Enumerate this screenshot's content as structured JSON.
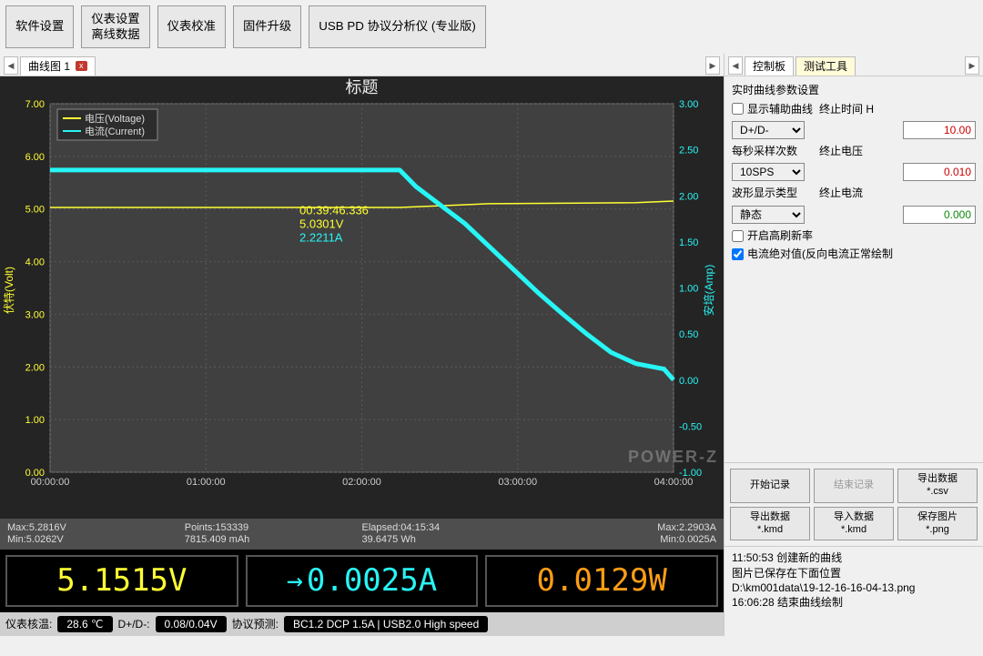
{
  "toolbar": {
    "software_settings": "软件设置",
    "meter_settings": "仪表设置\n离线数据",
    "meter_calib": "仪表校准",
    "firmware": "固件升级",
    "pd_analyzer": "USB PD 协议分析仪 (专业版)"
  },
  "left_tab": {
    "label": "曲线图 1"
  },
  "chart": {
    "title": "标题",
    "y1_label": "伏特(Volt)",
    "y2_label": "安培(Amp)",
    "legend_v": "电压(Voltage)",
    "legend_c": "电流(Current)",
    "cursor_time": "00:39:46.336",
    "cursor_v": "5.0301V",
    "cursor_a": "2.2211A",
    "watermark": "POWER-Z"
  },
  "chart_data": {
    "type": "line",
    "x_label": "",
    "x_ticks": [
      "00:00:00",
      "01:00:00",
      "02:00:00",
      "03:00:00",
      "04:00:00"
    ],
    "x_range_sec": [
      0,
      15334
    ],
    "y1_label": "伏特(Volt)",
    "y1_ticks": [
      0,
      1,
      2,
      3,
      4,
      5,
      6,
      7
    ],
    "y2_label": "安培(Amp)",
    "y2_ticks": [
      -1.0,
      -0.5,
      0,
      0.5,
      1.0,
      1.5,
      2.0,
      2.5,
      3.0
    ],
    "series": [
      {
        "name": "电压(Voltage)",
        "axis": "y1",
        "color": "#ffff33",
        "x_sec": [
          0,
          3600,
          7200,
          8600,
          10800,
          14400,
          15334
        ],
        "y": [
          5.03,
          5.03,
          5.03,
          5.03,
          5.1,
          5.12,
          5.15
        ]
      },
      {
        "name": "电流(Current)",
        "axis": "y2",
        "color": "#28f5f5",
        "x_sec": [
          0,
          3600,
          7200,
          8600,
          9000,
          9600,
          10200,
          10800,
          11400,
          12000,
          12600,
          13200,
          13800,
          14400,
          15100,
          15334
        ],
        "y": [
          2.28,
          2.28,
          2.28,
          2.28,
          2.1,
          1.9,
          1.7,
          1.45,
          1.2,
          0.95,
          0.72,
          0.5,
          0.3,
          0.18,
          0.12,
          0.0025
        ]
      }
    ]
  },
  "stats": {
    "max_v": "Max:5.2816V",
    "min_v": "Min:5.0262V",
    "points": "Points:153339",
    "mah": "7815.409 mAh",
    "elapsed": "Elapsed:04:15:34",
    "wh": "39.6475 Wh",
    "max_a": "Max:2.2903A",
    "min_a": "Min:0.0025A"
  },
  "big": {
    "voltage": "5.1515V",
    "current": "0.0025A",
    "power": "0.0129W"
  },
  "status": {
    "temp_label": "仪表核温:",
    "temp_value": "28.6 ℃",
    "dpdn_label": "D+/D-:",
    "dpdn_value": "0.08/0.04V",
    "proto_label": "协议预测:",
    "proto_value": "BC1.2 DCP 1.5A | USB2.0 High speed"
  },
  "right_tabs": {
    "control": "控制板",
    "tools": "测试工具"
  },
  "settings": {
    "title": "实时曲线参数设置",
    "aux_label": "显示辅助曲线",
    "aux_checked": false,
    "dropdown_aux": "D+/D-",
    "endtime_label": "终止时间 H",
    "endtime_value": "10.00",
    "sps_label": "每秒采样次数",
    "sps_value": "10SPS",
    "endv_label": "终止电压",
    "endv_value": "0.010",
    "wave_label": "波形显示类型",
    "wave_value": "静态",
    "endc_label": "终止电流",
    "endc_value": "0.000",
    "highrefresh_label": "开启高刷新率",
    "highrefresh_checked": false,
    "abs_label": "电流绝对值(反向电流正常绘制",
    "abs_checked": true
  },
  "buttons": {
    "start": "开始记录",
    "stop": "结束记录",
    "export_csv": "导出数据\n*.csv",
    "export_kmd": "导出数据\n*.kmd",
    "import_kmd": "导入数据\n*.kmd",
    "save_png": "保存图片\n*.png"
  },
  "log": "11:50:53 创建新的曲线\n图片已保存在下面位置\nD:\\km001data\\19-12-16-16-04-13.png\n16:06:28 结束曲线绘制"
}
